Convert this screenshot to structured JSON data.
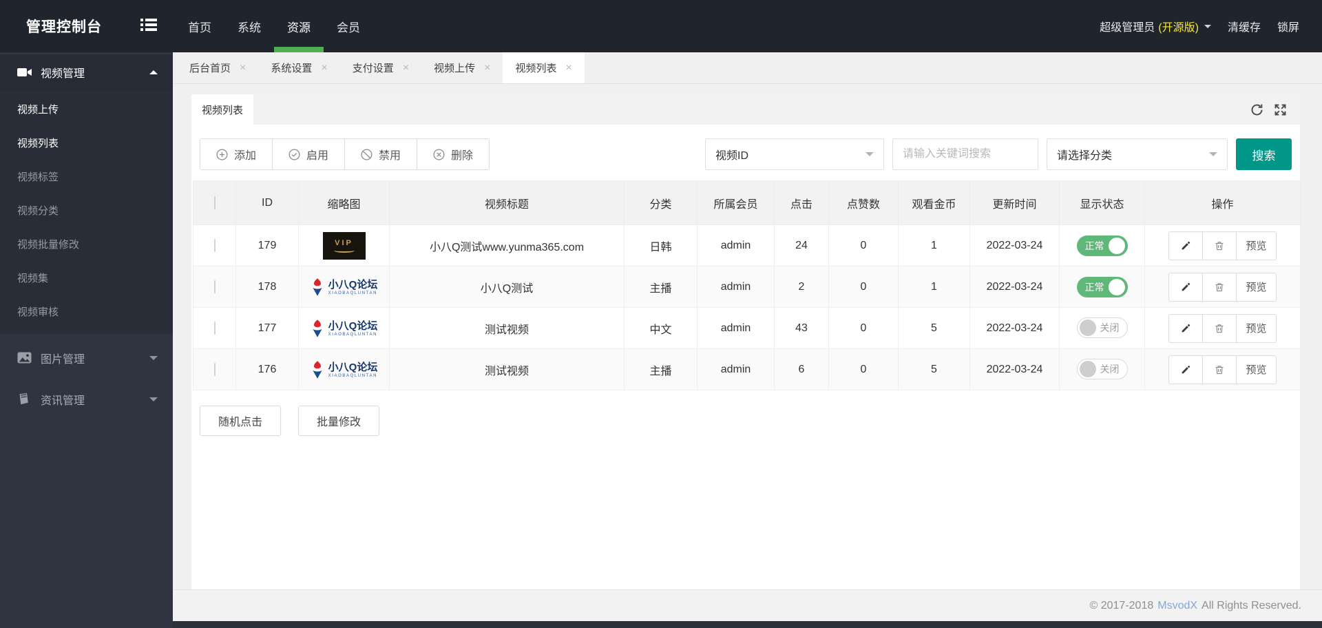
{
  "header": {
    "title": "管理控制台",
    "nav": [
      {
        "label": "首页",
        "active": false
      },
      {
        "label": "系统",
        "active": false
      },
      {
        "label": "资源",
        "active": true
      },
      {
        "label": "会员",
        "active": false
      }
    ],
    "user_name": "超级管理员",
    "user_edition": "(开源版)",
    "clear_cache": "清缓存",
    "lock_screen": "锁屏"
  },
  "sidebar": {
    "sections": [
      {
        "label": "视频管理",
        "icon": "video-icon",
        "expanded": true,
        "items": [
          {
            "label": "视频上传",
            "highlight": true
          },
          {
            "label": "视频列表",
            "highlight": true
          },
          {
            "label": "视频标签",
            "highlight": false
          },
          {
            "label": "视频分类",
            "highlight": false
          },
          {
            "label": "视频批量修改",
            "highlight": false
          },
          {
            "label": "视频集",
            "highlight": false
          },
          {
            "label": "视频审核",
            "highlight": false
          }
        ]
      },
      {
        "label": "图片管理",
        "icon": "image-icon",
        "expanded": false,
        "items": []
      },
      {
        "label": "资讯管理",
        "icon": "news-icon",
        "expanded": false,
        "items": []
      }
    ]
  },
  "tabs": [
    {
      "label": "后台首页",
      "active": false
    },
    {
      "label": "系统设置",
      "active": false
    },
    {
      "label": "支付设置",
      "active": false
    },
    {
      "label": "视频上传",
      "active": false
    },
    {
      "label": "视频列表",
      "active": true
    }
  ],
  "panel": {
    "title_tab": "视频列表",
    "toolbar": {
      "add": "添加",
      "enable": "启用",
      "disable": "禁用",
      "delete": "删除",
      "filter_selected": "视频ID",
      "keyword_placeholder": "请输入关键词搜索",
      "category_selected": "请选择分类",
      "search": "搜索"
    },
    "thumb_vip_text": "VIP",
    "logo_text": "小八Q论坛",
    "logo_caption": "XIAOBAQLUNTAN",
    "table": {
      "columns": [
        "ID",
        "缩略图",
        "视频标题",
        "分类",
        "所属会员",
        "点击",
        "点赞数",
        "观看金币",
        "更新时间",
        "显示状态",
        "操作"
      ],
      "preview_label": "预览",
      "rows": [
        {
          "id": "179",
          "thumb": "vip-banner",
          "title": "小八Q测试www.yunma365.com",
          "category": "日韩",
          "member": "admin",
          "clicks": "24",
          "likes": "0",
          "coins": "1",
          "updated": "2022-03-24",
          "status_label": "正常",
          "status_on": true
        },
        {
          "id": "178",
          "thumb": "xiaobaq-logo",
          "title": "小八Q测试",
          "category": "主播",
          "member": "admin",
          "clicks": "2",
          "likes": "0",
          "coins": "1",
          "updated": "2022-03-24",
          "status_label": "正常",
          "status_on": true
        },
        {
          "id": "177",
          "thumb": "xiaobaq-logo",
          "title": "测试视频",
          "category": "中文",
          "member": "admin",
          "clicks": "43",
          "likes": "0",
          "coins": "5",
          "updated": "2022-03-24",
          "status_label": "关闭",
          "status_on": false
        },
        {
          "id": "176",
          "thumb": "xiaobaq-logo",
          "title": "测试视频",
          "category": "主播",
          "member": "admin",
          "clicks": "6",
          "likes": "0",
          "coins": "5",
          "updated": "2022-03-24",
          "status_label": "关闭",
          "status_on": false
        }
      ]
    },
    "bottom_buttons": [
      "随机点击",
      "批量修改"
    ]
  },
  "footer": {
    "copyright": "© 2017-2018",
    "brand": "MsvodX",
    "rights": "All Rights Reserved."
  },
  "colors": {
    "accent_green": "#4caf50",
    "toggle_green": "#5FB878",
    "search_teal": "#009688",
    "edition_yellow": "#f5e539",
    "link_blue": "#85a7d6",
    "topbar_dark": "#20242c",
    "sidebar_dark": "#2f3440"
  }
}
